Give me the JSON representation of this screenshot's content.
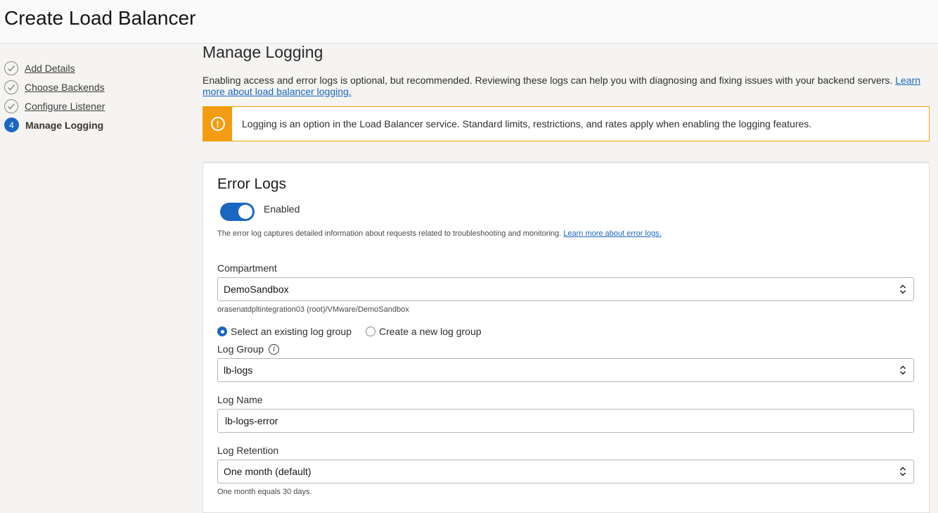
{
  "header": {
    "title": "Create Load Balancer"
  },
  "steps": [
    {
      "label": "Add Details",
      "status": "complete"
    },
    {
      "label": "Choose Backends",
      "status": "complete"
    },
    {
      "label": "Configure Listener",
      "status": "complete"
    },
    {
      "number": "4",
      "label": "Manage Logging",
      "status": "current"
    }
  ],
  "main": {
    "title": "Manage Logging",
    "intro_text": "Enabling access and error logs is optional, but recommended. Reviewing these logs can help you with diagnosing and fixing issues with your backend servers. ",
    "intro_link": "Learn more about load balancer logging.",
    "alert": {
      "icon": "warning-icon",
      "text": "Logging is an option in the Load Balancer service. Standard limits, restrictions, and rates apply when enabling the logging features.",
      "color": "#f39c12"
    }
  },
  "error_logs": {
    "title": "Error Logs",
    "toggle_label": "Enabled",
    "toggle_on": true,
    "help_text": "The error log captures detailed information about requests related to troubleshooting and monitoring. ",
    "help_link": "Learn more about error logs.",
    "compartment": {
      "label": "Compartment",
      "value": "DemoSandbox",
      "path": "orasenatdpltintegration03 (root)/VMware/DemoSandbox"
    },
    "log_group_mode": {
      "option_existing": "Select an existing log group",
      "option_new": "Create a new log group",
      "selected": "existing"
    },
    "log_group": {
      "label": "Log Group",
      "value": "lb-logs"
    },
    "log_name": {
      "label": "Log Name",
      "value": "lb-logs-error"
    },
    "log_retention": {
      "label": "Log Retention",
      "value": "One month (default)",
      "help": "One month equals 30 days."
    }
  },
  "colors": {
    "accent": "#1a67c2",
    "warning": "#f39c12"
  }
}
